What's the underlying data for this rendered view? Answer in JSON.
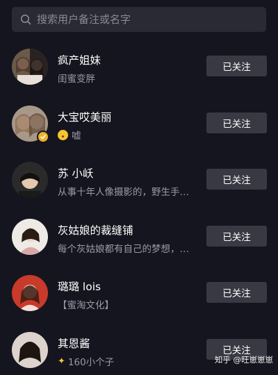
{
  "search": {
    "placeholder": "搜索用户备注或名字"
  },
  "users": [
    {
      "name": "疯产姐妹",
      "subtitle": "闺蜜变胖",
      "button": "已关注"
    },
    {
      "name": "大宝哎美丽",
      "subtitle": "嘘",
      "subtitle_icon": "shush-emoji-icon",
      "button": "已关注",
      "verified": true
    },
    {
      "name": "苏 小岆",
      "subtitle": "从事十年人像摄影的，野生手…",
      "button": "已关注"
    },
    {
      "name": "灰姑娘的裁缝铺",
      "subtitle": "每个灰姑娘都有自己的梦想，…",
      "button": "已关注"
    },
    {
      "name": "璐璐 lois",
      "subtitle": "【蜜淘文化】",
      "button": "已关注"
    },
    {
      "name": "其恩酱",
      "subtitle": "160小个子",
      "subtitle_icon": "sparkle-emoji-icon",
      "button": "已关注"
    }
  ],
  "watermark": "知乎 @旺崽崽崽",
  "colors": {
    "background": "#15151f",
    "search_bg": "#2a2a35",
    "button_bg": "#393943",
    "subtitle": "#9a9aa4",
    "verified_badge": "#f0b12a"
  }
}
